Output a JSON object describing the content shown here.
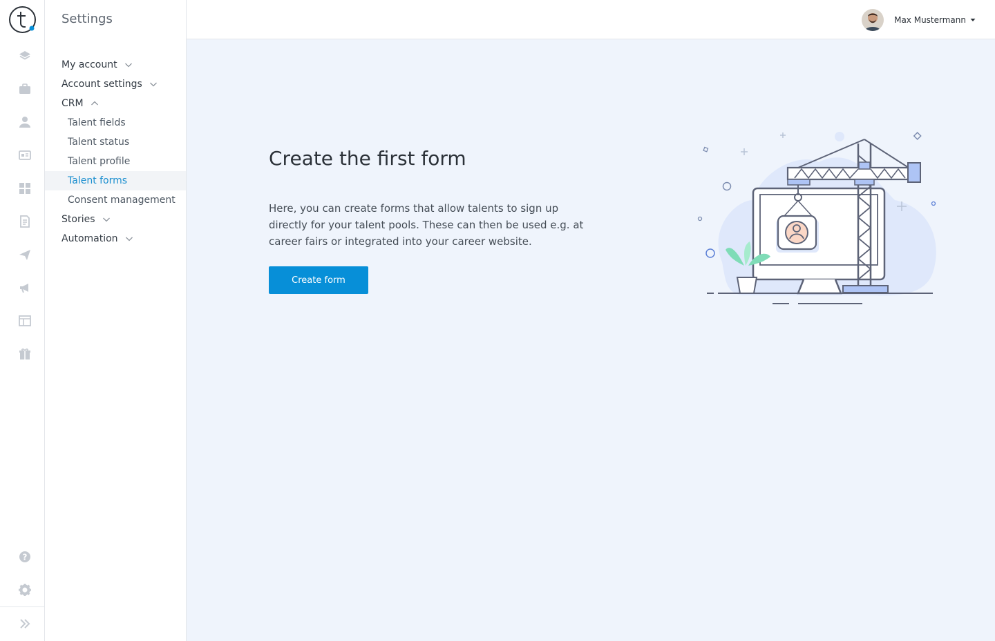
{
  "sidebar": {
    "title": "Settings",
    "items": [
      {
        "label": "My account",
        "expanded": false
      },
      {
        "label": "Account settings",
        "expanded": false
      },
      {
        "label": "CRM",
        "expanded": true,
        "children": [
          {
            "label": "Talent fields"
          },
          {
            "label": "Talent status"
          },
          {
            "label": "Talent profile"
          },
          {
            "label": "Talent forms",
            "active": true
          },
          {
            "label": "Consent management"
          }
        ]
      },
      {
        "label": "Stories",
        "expanded": false
      },
      {
        "label": "Automation",
        "expanded": false
      }
    ]
  },
  "rail": {
    "icons": [
      "layers-icon",
      "briefcase-icon",
      "person-icon",
      "id-card-icon",
      "dashboard-icon",
      "document-icon",
      "paper-plane-icon",
      "megaphone-icon",
      "calendar-table-icon",
      "gift-icon",
      "help-icon",
      "gear-icon",
      "expand-icon"
    ]
  },
  "header": {
    "user_name": "Max Mustermann"
  },
  "main": {
    "title": "Create the first form",
    "description": "Here, you can create forms that allow talents to sign up directly for your talent pools. These can then be used e.g. at career fairs or integrated into your career website.",
    "button_label": "Create form"
  },
  "colors": {
    "accent": "#078fd8",
    "active_link": "#1a8ecf",
    "background": "#eff4fc",
    "rail_icon": "#c5cad1"
  }
}
